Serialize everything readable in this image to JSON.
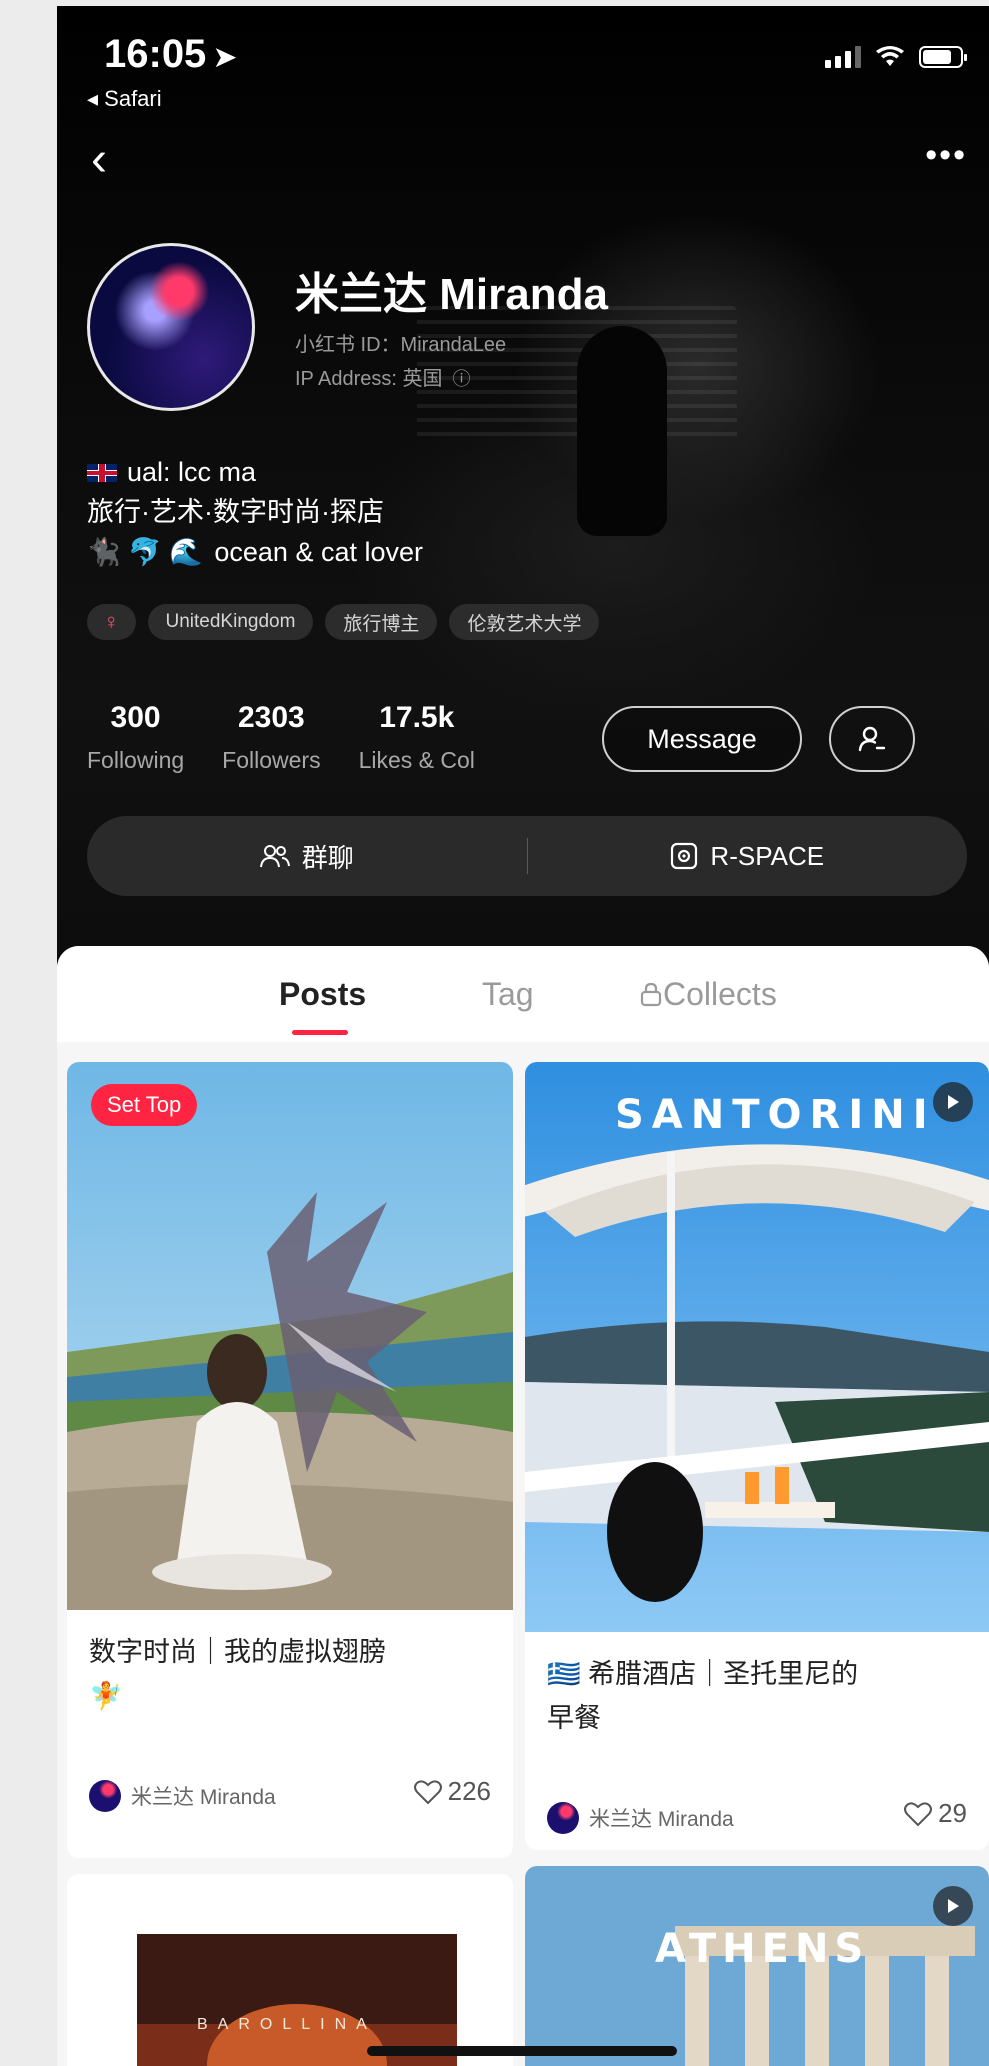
{
  "status": {
    "time": "16:05",
    "back_app": "◂ Safari"
  },
  "profile": {
    "name": "米兰达 Miranda",
    "red_id": "小红书 ID：MirandaLee",
    "ip_address": "IP Address: 英国",
    "bio_lines": [
      "ual: lcc ma",
      "旅行·艺术·数字时尚·探店",
      "ocean & cat lover"
    ],
    "bio_emojis": "🐈‍⬛ 🐬 🌊",
    "tags": [
      "♀",
      "UnitedKingdom",
      "旅行博主",
      "伦敦艺术大学"
    ]
  },
  "stats": [
    {
      "value": "300",
      "label": "Following"
    },
    {
      "value": "2303",
      "label": "Followers"
    },
    {
      "value": "17.5k",
      "label": "Likes & Col"
    }
  ],
  "actions": {
    "message_label": "Message",
    "group_chat_label": "群聊",
    "rspace_label": "R-SPACE"
  },
  "tabs": [
    "Posts",
    "Tag",
    "Collects"
  ],
  "active_tab": "Posts",
  "posts": [
    {
      "badge": "Set Top",
      "title_line1": "数字时尚｜我的虚拟翅膀",
      "title_line2": "🧚",
      "author": "米兰达 Miranda",
      "likes": "226"
    },
    {
      "overlay_text": "SANTORINI",
      "title_line1": "🇬🇷 希腊酒店｜圣托里尼的",
      "title_line2": "早餐",
      "author": "米兰达 Miranda",
      "likes": "29"
    },
    {
      "overlay_text": "ATHENS"
    },
    {
      "overlay_text": "BAROLLINA"
    }
  ],
  "colors": {
    "accent": "#ff2442",
    "header_bg": "#000000",
    "panel_bg": "#f6f6f6"
  }
}
